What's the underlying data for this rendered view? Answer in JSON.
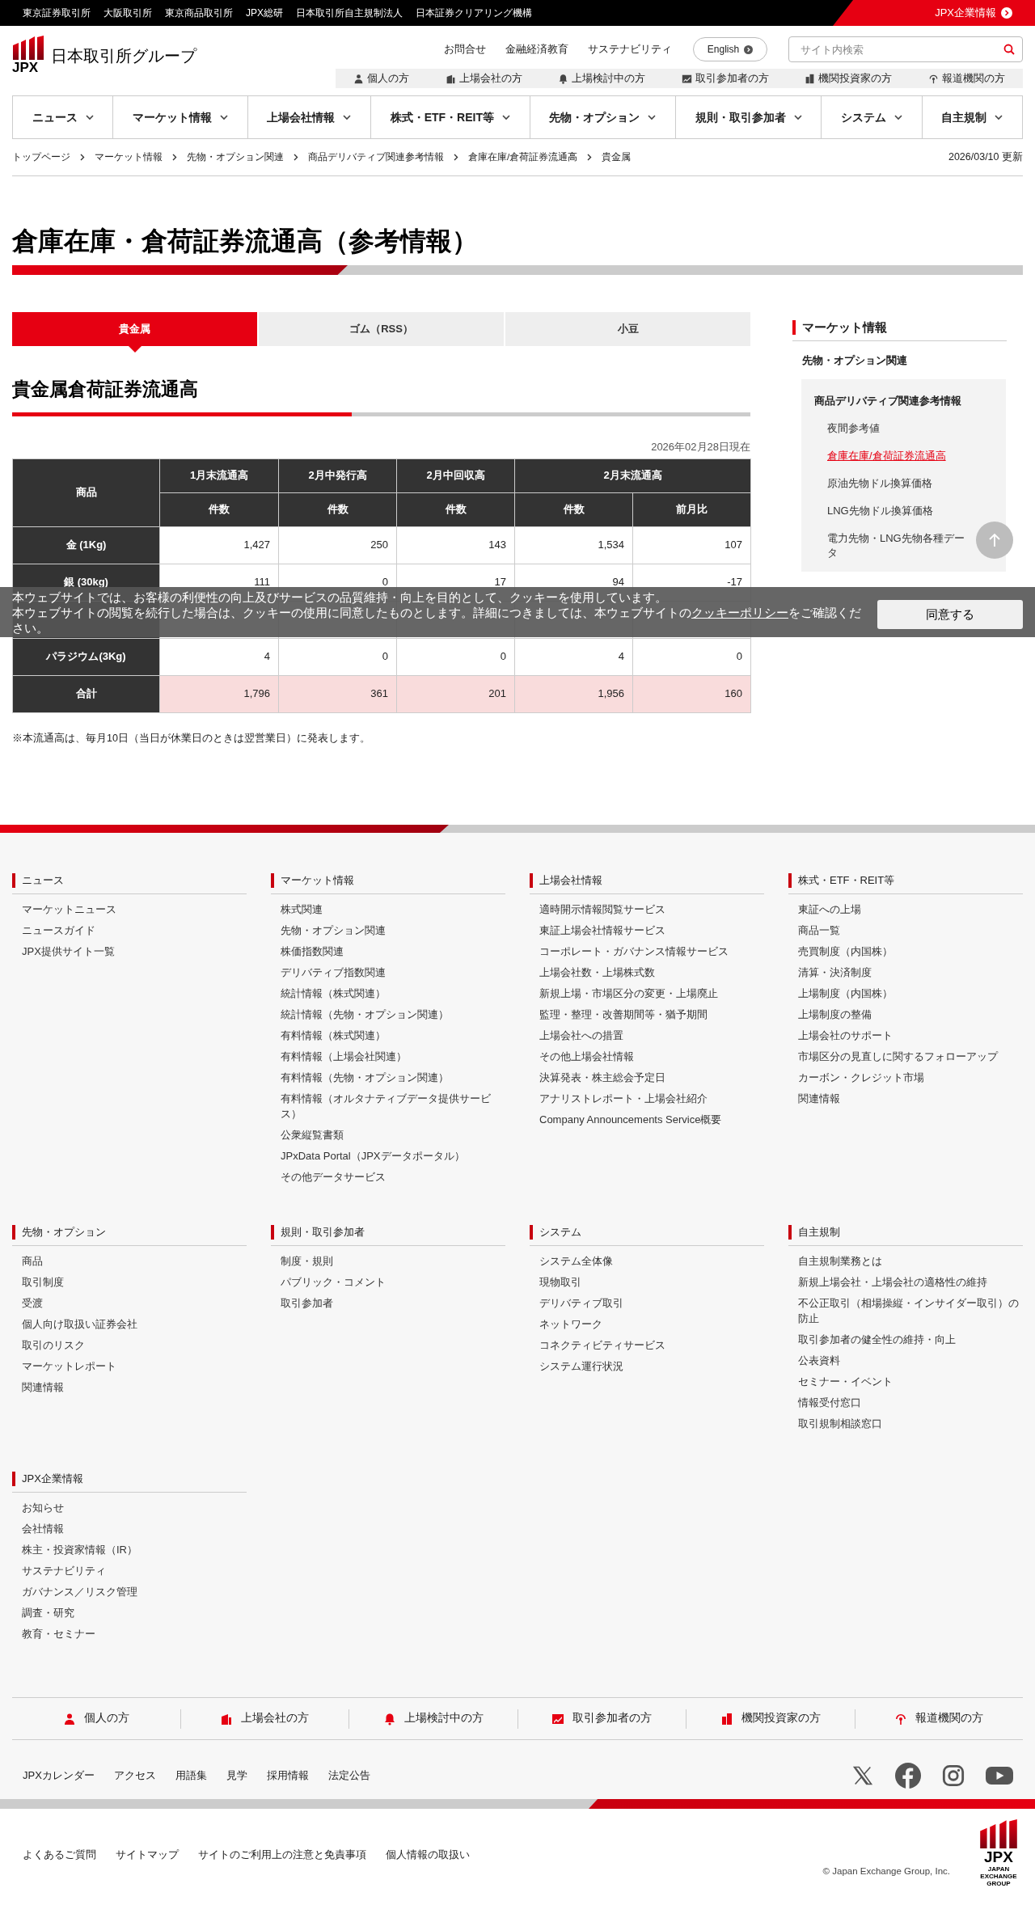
{
  "top_bar": {
    "links": [
      "東京証券取引所",
      "大阪取引所",
      "東京商品取引所",
      "JPX総研",
      "日本取引所自主規制法人",
      "日本証券クリアリング機構"
    ],
    "corporate_link": "JPX企業情報"
  },
  "header": {
    "logo_text": "JPX",
    "site_name": "日本取引所グループ",
    "utility_links": [
      "お問合せ",
      "金融経済教育",
      "サステナビリティ"
    ],
    "language_button": "English",
    "search": {
      "placeholder": "サイト内検索"
    },
    "audience_links": [
      {
        "label": "個人の方",
        "kind": "person"
      },
      {
        "label": "上場会社の方",
        "kind": "building"
      },
      {
        "label": "上場検討中の方",
        "kind": "bell"
      },
      {
        "label": "取引参加者の方",
        "kind": "chart"
      },
      {
        "label": "機関投資家の方",
        "kind": "device"
      },
      {
        "label": "報道機関の方",
        "kind": "broadcast"
      }
    ]
  },
  "main_nav": [
    "ニュース",
    "マーケット情報",
    "上場会社情報",
    "株式・ETF・REIT等",
    "先物・オプション",
    "規則・取引参加者",
    "システム",
    "自主規制"
  ],
  "breadcrumb": [
    "トップページ",
    "マーケット情報",
    "先物・オプション関連",
    "商品デリバティブ関連参考情報",
    "倉庫在庫/倉荷証券流通高",
    "貴金属"
  ],
  "updated": "2026/03/10 更新",
  "page_title": "倉庫在庫・倉荷証券流通高（参考情報）",
  "tabs": [
    {
      "label": "貴金属",
      "selected": true
    },
    {
      "label": "ゴム（RSS）",
      "selected": false
    },
    {
      "label": "小豆",
      "selected": false
    }
  ],
  "section_title": "貴金属倉荷証券流通高",
  "as_of": "2026年02月28日現在",
  "table": {
    "corner": "商品",
    "groups": [
      "1月末流通高",
      "2月中発行高",
      "2月中回収高",
      "2月末流通高"
    ],
    "subcolumns": [
      "件数",
      "件数",
      "件数",
      "件数",
      "前月比"
    ],
    "rows": [
      {
        "kind": "item",
        "name": "金 (1Kg)",
        "cells": [
          "1,427",
          "250",
          "143",
          "1,534",
          "107"
        ]
      },
      {
        "kind": "item",
        "name": "銀 (30kg)",
        "cells": [
          "111",
          "0",
          "17",
          "94",
          "-17"
        ]
      },
      {
        "kind": "covered"
      },
      {
        "kind": "item",
        "name": "パラジウム(3Kg)",
        "cells": [
          "4",
          "0",
          "0",
          "4",
          "0"
        ]
      },
      {
        "kind": "total",
        "name": "合計",
        "cells": [
          "1,796",
          "361",
          "201",
          "1,956",
          "160"
        ]
      }
    ]
  },
  "note": "※本流通高は、毎月10日（当日が休業日のときは翌営業日）に発表します。",
  "sidebar": {
    "title": "マーケット情報",
    "section": "先物・オプション関連",
    "group": "商品デリバティブ関連参考情報",
    "items": [
      {
        "label": "夜間参考値",
        "selected": false
      },
      {
        "label": "倉庫在庫/倉荷証券流通高",
        "selected": true
      },
      {
        "label": "原油先物ドル換算価格",
        "selected": false
      },
      {
        "label": "LNG先物ドル換算価格",
        "selected": false
      },
      {
        "label": "電力先物・LNG先物各種データ",
        "selected": false
      }
    ]
  },
  "cookie_banner": {
    "line_1": "本ウェブサイトでは、お客様の利便性の向上及びサービスの品質維持・向上を目的として、クッキーを使用しています。",
    "line_2": "本ウェブサイトの閲覧を続行した場合は、クッキーの使用に同意したものとします。詳細につきましては、本ウェブサイトの",
    "link": "クッキーポリシー",
    "after_link": "をご確認ください。",
    "button": "同意する"
  },
  "footer": {
    "columns": [
      {
        "title": "ニュース",
        "links": [
          "マーケットニュース",
          "ニュースガイド",
          "JPX提供サイト一覧"
        ]
      },
      {
        "title": "マーケット情報",
        "links": [
          "株式関連",
          "先物・オプション関連",
          "株価指数関連",
          "デリバティブ指数関連",
          "統計情報（株式関連）",
          "統計情報（先物・オプション関連）",
          "有料情報（株式関連）",
          "有料情報（上場会社関連）",
          "有料情報（先物・オプション関連）",
          "有料情報（オルタナティブデータ提供サービス）",
          "公衆縦覧書類",
          "JPxData Portal（JPXデータポータル）",
          "その他データサービス"
        ]
      },
      {
        "title": "上場会社情報",
        "links": [
          "適時開示情報閲覧サービス",
          "東証上場会社情報サービス",
          "コーポレート・ガバナンス情報サービス",
          "上場会社数・上場株式数",
          "新規上場・市場区分の変更・上場廃止",
          "監理・整理・改善期間等・猶予期間",
          "上場会社への措置",
          "その他上場会社情報",
          "決算発表・株主総会予定日",
          "アナリストレポート・上場会社紹介",
          "Company Announcements Service概要"
        ]
      },
      {
        "title": "株式・ETF・REIT等",
        "links": [
          "東証への上場",
          "商品一覧",
          "売買制度（内国株）",
          "清算・決済制度",
          "上場制度（内国株）",
          "上場制度の整備",
          "上場会社のサポート",
          "市場区分の見直しに関するフォローアップ",
          "カーボン・クレジット市場",
          "関連情報"
        ]
      },
      {
        "title": "先物・オプション",
        "links": [
          "商品",
          "取引制度",
          "受渡",
          "個人向け取扱い証券会社",
          "取引のリスク",
          "マーケットレポート",
          "関連情報"
        ]
      },
      {
        "title": "規則・取引参加者",
        "links": [
          "制度・規則",
          "パブリック・コメント",
          "取引参加者"
        ]
      },
      {
        "title": "システム",
        "links": [
          "システム全体像",
          "現物取引",
          "デリバティブ取引",
          "ネットワーク",
          "コネクティビティサービス",
          "システム運行状況"
        ]
      },
      {
        "title": "自主規制",
        "links": [
          "自主規制業務とは",
          "新規上場会社・上場会社の適格性の維持",
          "不公正取引（相場操縦・インサイダー取引）の防止",
          "取引参加者の健全性の維持・向上",
          "公表資料",
          "セミナー・イベント",
          "情報受付窓口",
          "取引規制相談窓口"
        ]
      },
      {
        "title": "JPX企業情報",
        "links": [
          "お知らせ",
          "会社情報",
          "株主・投資家情報（IR）",
          "サステナビリティ",
          "ガバナンス／リスク管理",
          "調査・研究",
          "教育・セミナー"
        ]
      }
    ],
    "audience_links": [
      {
        "label": "個人の方",
        "kind": "person"
      },
      {
        "label": "上場会社の方",
        "kind": "building"
      },
      {
        "label": "上場検討中の方",
        "kind": "bell"
      },
      {
        "label": "取引参加者の方",
        "kind": "chart"
      },
      {
        "label": "機関投資家の方",
        "kind": "device"
      },
      {
        "label": "報道機関の方",
        "kind": "broadcast"
      }
    ],
    "links": [
      "JPXカレンダー",
      "アクセス",
      "用語集",
      "見学",
      "採用情報",
      "法定公告"
    ],
    "social": [
      {
        "kind": "x"
      },
      {
        "kind": "facebook"
      },
      {
        "kind": "instagram"
      },
      {
        "kind": "youtube"
      }
    ],
    "bottom_links": [
      "よくあるご質問",
      "サイトマップ",
      "サイトのご利用上の注意と免責事項",
      "個人情報の取扱い"
    ],
    "copyright": "© Japan Exchange Group, Inc.",
    "logo_text": "JPX",
    "logo_subtext": "JAPAN EXCHANGE GROUP"
  }
}
